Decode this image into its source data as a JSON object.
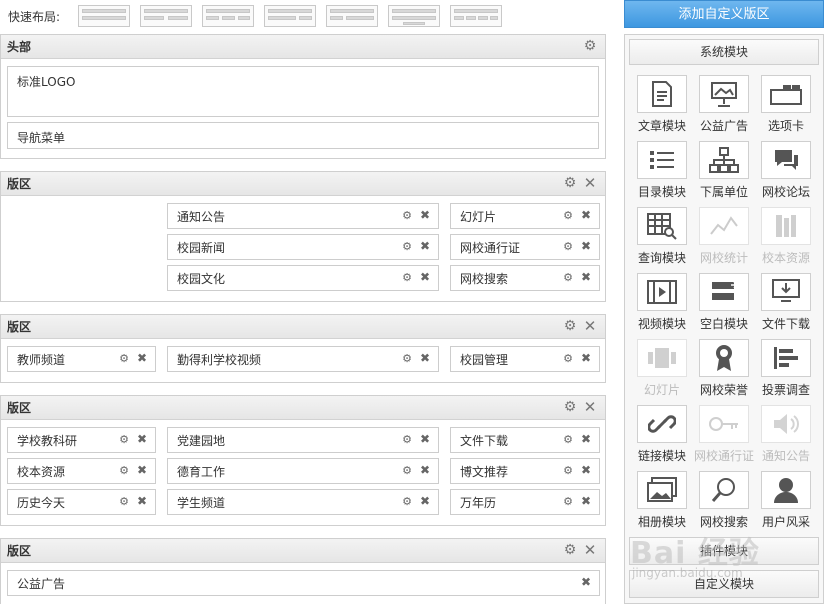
{
  "quick_layout": {
    "label": "快速布局:",
    "thumbs": [
      "layout-1",
      "layout-2",
      "layout-3",
      "layout-4",
      "layout-5",
      "layout-6",
      "layout-7"
    ]
  },
  "sections": {
    "header": {
      "title": "头部",
      "logo": "标准LOGO",
      "nav": "导航菜单"
    },
    "block1": {
      "title": "版区",
      "col2": [
        "通知公告",
        "校园新闻",
        "校园文化"
      ],
      "col3": [
        "幻灯片",
        "网校通行证",
        "网校搜索"
      ]
    },
    "block2": {
      "title": "版区",
      "col1": [
        "教师频道"
      ],
      "col2": [
        "勤得利学校视频"
      ],
      "col3": [
        "校园管理"
      ]
    },
    "block3": {
      "title": "版区",
      "col1": [
        "学校教科研",
        "校本资源",
        "历史今天"
      ],
      "col2": [
        "党建园地",
        "德育工作",
        "学生频道"
      ],
      "col3": [
        "文件下载",
        "博文推荐",
        "万年历"
      ]
    },
    "block4": {
      "title": "版区",
      "full": "公益广告"
    }
  },
  "icons": {
    "gear": "⚙",
    "close": "✕",
    "small_close": "✖"
  },
  "sidebar": {
    "add_button": "添加自定义版区",
    "system_modules": "系统模块",
    "tiles": [
      {
        "label": "文章模块",
        "icon": "document-icon",
        "disabled": false
      },
      {
        "label": "公益广告",
        "icon": "billboard-icon",
        "disabled": false
      },
      {
        "label": "选项卡",
        "icon": "tabs-icon",
        "disabled": false
      },
      {
        "label": "目录模块",
        "icon": "list-icon",
        "disabled": false
      },
      {
        "label": "下属单位",
        "icon": "org-chart-icon",
        "disabled": false
      },
      {
        "label": "网校论坛",
        "icon": "chat-bubbles-icon",
        "disabled": false
      },
      {
        "label": "查询模块",
        "icon": "table-search-icon",
        "disabled": false
      },
      {
        "label": "网校统计",
        "icon": "line-chart-icon",
        "disabled": true
      },
      {
        "label": "校本资源",
        "icon": "books-icon",
        "disabled": true
      },
      {
        "label": "视频模块",
        "icon": "film-icon",
        "disabled": false
      },
      {
        "label": "空白模块",
        "icon": "blank-blocks-icon",
        "disabled": false
      },
      {
        "label": "文件下载",
        "icon": "download-icon",
        "disabled": false
      },
      {
        "label": "幻灯片",
        "icon": "slides-icon",
        "disabled": true
      },
      {
        "label": "网校荣誉",
        "icon": "medal-icon",
        "disabled": false
      },
      {
        "label": "投票调查",
        "icon": "bar-chart-icon",
        "disabled": false
      },
      {
        "label": "链接模块",
        "icon": "link-icon",
        "disabled": false
      },
      {
        "label": "网校通行证",
        "icon": "key-icon",
        "disabled": true
      },
      {
        "label": "通知公告",
        "icon": "speaker-icon",
        "disabled": true
      },
      {
        "label": "相册模块",
        "icon": "photo-album-icon",
        "disabled": false
      },
      {
        "label": "网校搜索",
        "icon": "magnifier-icon",
        "disabled": false
      },
      {
        "label": "用户风采",
        "icon": "user-icon",
        "disabled": false
      }
    ],
    "btn_plugin": "插件模块",
    "btn_custom": "自定义模块"
  },
  "watermark": {
    "brand": "Bai 经验",
    "url": "jingyan.baidu.com"
  }
}
